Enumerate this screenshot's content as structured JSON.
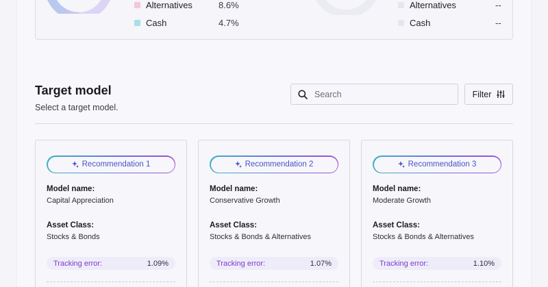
{
  "allocation": {
    "current": [
      {
        "label": "Alternatives",
        "value": "8.6%",
        "color": "#f7c6d9"
      },
      {
        "label": "Cash",
        "value": "4.7%",
        "color": "#a6e1ea"
      }
    ],
    "target": [
      {
        "label": "Alternatives",
        "value": "--",
        "color": "#e6e6ee"
      },
      {
        "label": "Cash",
        "value": "--",
        "color": "#e6e6ee"
      }
    ]
  },
  "target_model": {
    "title": "Target model",
    "subtitle": "Select a target model.",
    "search": {
      "placeholder": "Search",
      "value": ""
    },
    "filter_label": "Filter"
  },
  "labels": {
    "model_name": "Model name:",
    "asset_class": "Asset Class:",
    "tracking_error": "Tracking error:"
  },
  "recommendations": [
    {
      "label": "Recommendation 1",
      "model_name": "Capital Appreciation",
      "asset_class": "Stocks & Bonds",
      "tracking_error": "1.09%"
    },
    {
      "label": "Recommendation 2",
      "model_name": "Conservative Growth",
      "asset_class": "Stocks & Bonds & Alternatives",
      "tracking_error": "1.07%"
    },
    {
      "label": "Recommendation 3",
      "model_name": "Moderate Growth",
      "asset_class": "Stocks & Bonds & Alternatives",
      "tracking_error": "1.10%"
    }
  ],
  "colors": {
    "accent": "#4a52c9",
    "tracking_label": "#7a3cc8",
    "pill_gradient": [
      "#3fb0c4",
      "#6f6ee0",
      "#a14fd6"
    ]
  }
}
